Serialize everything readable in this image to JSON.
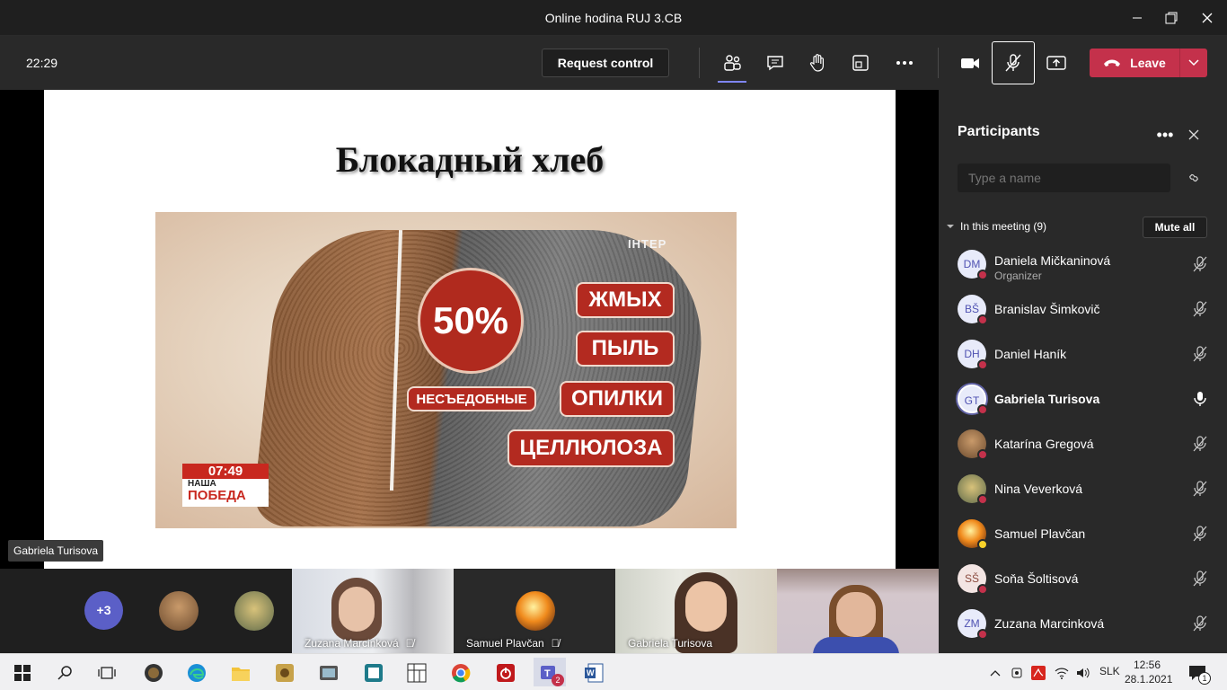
{
  "window": {
    "title": "Online hodina RUJ 3.CB"
  },
  "toolbar": {
    "time": "22:29",
    "request_control": "Request control",
    "leave_label": "Leave"
  },
  "slide": {
    "title": "Блокадный хлеб",
    "photo": {
      "percent": "50%",
      "labels": [
        "ЖМЫХ",
        "ПЫЛЬ",
        "НЕСЪЕДОБНЫЕ",
        "ОПИЛКИ",
        "ЦЕЛЛЮЛОЗА"
      ],
      "channel": "IНТЕР",
      "clock_time": "07:49",
      "program_line1": "НАША",
      "program_line2": "ПОБЕДА"
    }
  },
  "presenter_tag": "Gabriela Turisova",
  "gallery": {
    "more": "+3",
    "tiles": [
      {
        "name": "Zuzana Marcinková"
      },
      {
        "name": "Samuel Plavčan"
      },
      {
        "name": "Gabriela Turisova"
      }
    ]
  },
  "participants": {
    "title": "Participants",
    "search_placeholder": "Type a name",
    "section": "In this meeting (9)",
    "mute_all": "Mute all",
    "list": [
      {
        "initials": "DM",
        "name": "Daniela Mičkaninová",
        "sub": "Organizer"
      },
      {
        "initials": "BŠ",
        "name": "Branislav Šimkovič"
      },
      {
        "initials": "DH",
        "name": "Daniel Haník"
      },
      {
        "initials": "GT",
        "name": "Gabriela Turisova"
      },
      {
        "initials": "",
        "name": "Katarína Gregová"
      },
      {
        "initials": "",
        "name": "Nina Veverková"
      },
      {
        "initials": "",
        "name": "Samuel Plavčan"
      },
      {
        "initials": "SŠ",
        "name": "Soňa Šoltisová"
      },
      {
        "initials": "ZM",
        "name": "Zuzana Marcinková"
      }
    ]
  },
  "taskbar": {
    "lang": "SLK",
    "time": "12:56",
    "date": "28.1.2021",
    "teams_badge": "2",
    "notif_count": "1"
  },
  "colors": {
    "accent": "#5b5fc7",
    "leave": "#c4314b",
    "panel": "#292929"
  }
}
